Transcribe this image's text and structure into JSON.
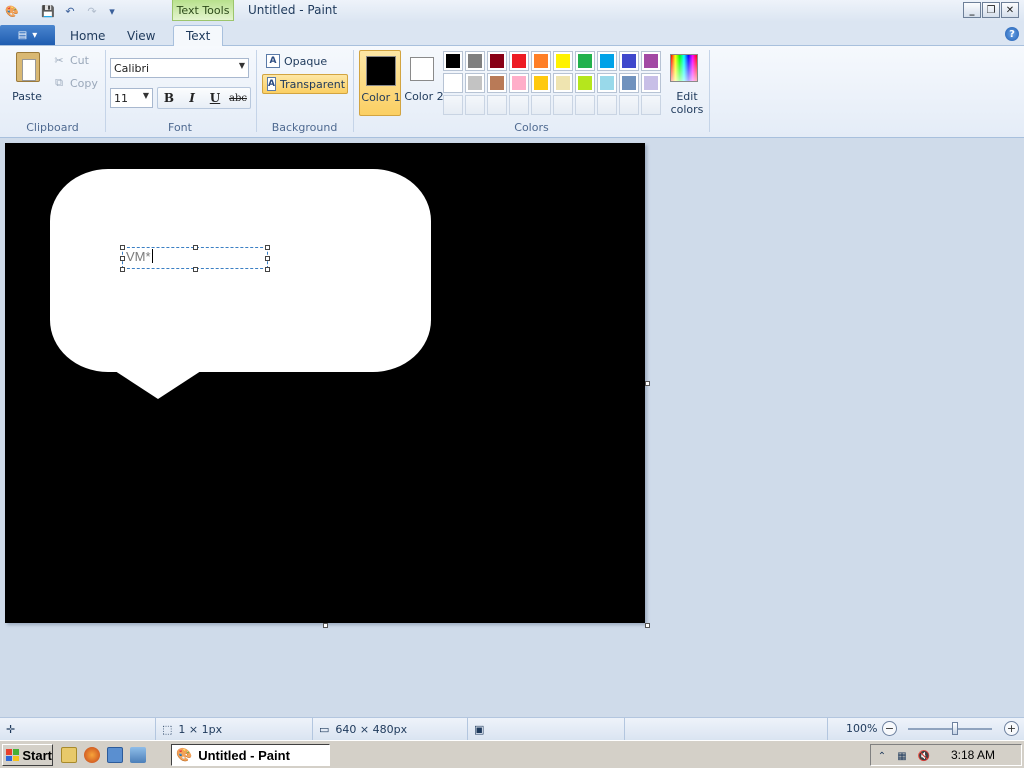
{
  "titlebar": {
    "context_tab": "Text Tools",
    "title": "Untitled - Paint",
    "minimize": "_",
    "restore": "❐",
    "close": "✕"
  },
  "tabs": {
    "home": "Home",
    "view": "View",
    "text": "Text"
  },
  "clipboard": {
    "paste": "Paste",
    "cut": "Cut",
    "copy": "Copy",
    "label": "Clipboard"
  },
  "font": {
    "family": "Calibri",
    "size": "11",
    "bold": "B",
    "italic": "I",
    "underline": "U",
    "strikethrough": "abc",
    "label": "Font"
  },
  "background": {
    "opaque": "Opaque",
    "transparent": "Transparent",
    "label": "Background"
  },
  "colors": {
    "color1_label": "Color 1",
    "color2_label": "Color 2",
    "color1": "#000000",
    "color2": "#ffffff",
    "edit_colors": "Edit colors",
    "label": "Colors",
    "palette": [
      "#000000",
      "#7f7f7f",
      "#880015",
      "#ed1c24",
      "#ff7f27",
      "#fff200",
      "#22b14c",
      "#00a2e8",
      "#3f48cc",
      "#a349a4",
      "#ffffff",
      "#c3c3c3",
      "#b97a57",
      "#ffaec9",
      "#ffc90e",
      "#efe4b0",
      "#b5e61d",
      "#99d9ea",
      "#7092be",
      "#c8bfe7"
    ]
  },
  "canvas": {
    "text": "VM*"
  },
  "statusbar": {
    "selection": "1 × 1px",
    "canvas_size": "640 × 480px",
    "zoom": "100%"
  },
  "taskbar": {
    "start": "Start",
    "task_title": "Untitled - Paint",
    "clock": "3:18 AM"
  }
}
